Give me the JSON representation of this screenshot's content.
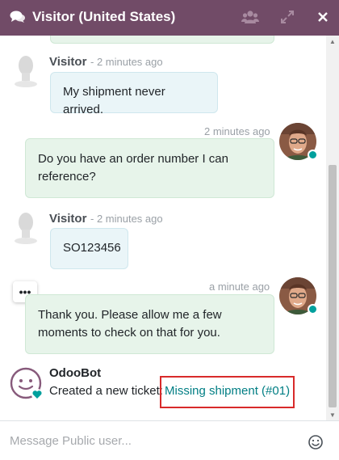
{
  "header": {
    "title": "Visitor (United States)",
    "icons": [
      "chat-bubbles-icon",
      "users-icon",
      "expand-icon",
      "close-icon"
    ],
    "background": "#714b67"
  },
  "messages": [
    {
      "role": "visitor",
      "author": "Visitor",
      "time": "- 2 minutes ago",
      "text": "My shipment never arrived."
    },
    {
      "role": "agent",
      "time": "2 minutes ago",
      "text_lines": [
        "Do you have an order number I can",
        "reference?"
      ]
    },
    {
      "role": "visitor",
      "author": "Visitor",
      "time": "- 2 minutes ago",
      "text": "SO123456"
    },
    {
      "role": "agent",
      "time": "a minute ago",
      "text_lines": [
        "Thank you. Please allow me a few",
        "moments to check on that for you."
      ]
    }
  ],
  "bot": {
    "name": "OdooBot",
    "message": "Created a new ticket:",
    "link": "Missing shipment (#01)"
  },
  "more_button": "•••",
  "composer": {
    "placeholder": "Message Public user...",
    "value": ""
  },
  "colors": {
    "accent": "#714b67",
    "online": "#00a09d",
    "link": "#017e84",
    "highlight": "#d82a2a"
  }
}
